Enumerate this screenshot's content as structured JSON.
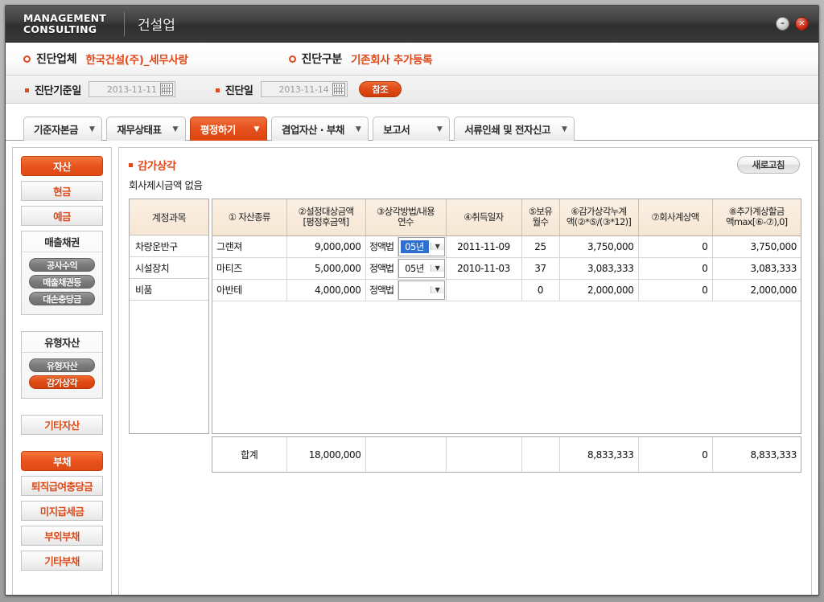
{
  "titlebar": {
    "brand_line1": "MANAGEMENT",
    "brand_line2": "CONSULTING",
    "subtitle": "건설업",
    "minimize_glyph": "–",
    "close_glyph": "✕"
  },
  "info": {
    "company_label": "진단업체",
    "company_value": "한국건설(주)_세무사랑",
    "type_label": "진단구분",
    "type_value": "기존회사  추가등록"
  },
  "dates": {
    "base_label": "진단기준일",
    "base_value": "2013-11-11",
    "diag_label": "진단일",
    "diag_value": "2013-11-14",
    "reference_button": "참조"
  },
  "tabs": [
    {
      "label": "기준자본금",
      "caret": "▼",
      "active": false
    },
    {
      "label": "재무상태표",
      "caret": "▼",
      "active": false
    },
    {
      "label": "평정하기",
      "caret": "▼",
      "active": true
    },
    {
      "label": "겸업자산 · 부채",
      "caret": "▼",
      "active": false
    },
    {
      "label": "보고서",
      "caret": "▼",
      "active": false
    },
    {
      "label": "서류인쇄 및 전자신고",
      "caret": "▼",
      "active": false
    }
  ],
  "sidebar": {
    "items": [
      {
        "kind": "primary",
        "label": "자산"
      },
      {
        "kind": "btn",
        "label": "현금"
      },
      {
        "kind": "btn",
        "label": "예금"
      },
      {
        "kind": "group",
        "label": "매출채권",
        "pills": [
          {
            "label": "공사수익",
            "active": false
          },
          {
            "label": "매출채권등",
            "active": false
          },
          {
            "label": "대손충당금",
            "active": false
          }
        ]
      },
      {
        "kind": "spacer"
      },
      {
        "kind": "group",
        "label": "유형자산",
        "pills": [
          {
            "label": "유형자산",
            "active": false
          },
          {
            "label": "감가상각",
            "active": true
          }
        ]
      },
      {
        "kind": "spacer"
      },
      {
        "kind": "btn",
        "label": "기타자산"
      },
      {
        "kind": "spacer"
      },
      {
        "kind": "primary",
        "label": "부채"
      },
      {
        "kind": "btn",
        "label": "퇴직급여충당금"
      },
      {
        "kind": "btn",
        "label": "미지급세금"
      },
      {
        "kind": "btn",
        "label": "부외부채"
      },
      {
        "kind": "btn",
        "label": "기타부채"
      }
    ]
  },
  "content": {
    "section_title": "감가상각",
    "section_note": "회사제시금액  없음",
    "refresh_button": "새로고침"
  },
  "table": {
    "account_header": "계정과목",
    "headers": [
      {
        "line1": "① 자산종류",
        "line2": ""
      },
      {
        "line1": "②설정대상금액",
        "line2": "[평정후금액]"
      },
      {
        "line1": "③상각방법/내용",
        "line2": "연수"
      },
      {
        "line1": "④취득일자",
        "line2": ""
      },
      {
        "line1": "⑤보유",
        "line2": "월수"
      },
      {
        "line1": "⑥감가상각누계",
        "line2": "액(②*⑤/(③*12)]"
      },
      {
        "line1": "⑦회사계상액",
        "line2": ""
      },
      {
        "line1": "⑧추가계상할금",
        "line2": "액max[⑥-⑦),0]"
      }
    ],
    "rows": [
      {
        "account": "차량운반구",
        "asset_type": "그랜져",
        "amount": "9,000,000",
        "method": "정액법",
        "years": "05년",
        "years_selected": true,
        "acquire_date": "2011-11-09",
        "months": "25",
        "accum_depr": "3,750,000",
        "company_amount": "0",
        "extra_amount": "3,750,000"
      },
      {
        "account": "시설장치",
        "asset_type": "마티즈",
        "amount": "5,000,000",
        "method": "정액법",
        "years": "05년",
        "years_selected": false,
        "acquire_date": "2010-11-03",
        "months": "37",
        "accum_depr": "3,083,333",
        "company_amount": "0",
        "extra_amount": "3,083,333"
      },
      {
        "account": "비품",
        "asset_type": "아반테",
        "amount": "4,000,000",
        "method": "정액법",
        "years": "",
        "years_selected": false,
        "acquire_date": "",
        "months": "0",
        "accum_depr": "2,000,000",
        "company_amount": "0",
        "extra_amount": "2,000,000"
      }
    ],
    "total": {
      "label": "합계",
      "amount": "18,000,000",
      "accum_depr": "8,833,333",
      "company_amount": "0",
      "extra_amount": "8,833,333"
    },
    "dropdown_caret": "▼"
  },
  "colors": {
    "accent": "#e0491b",
    "header_bg": "#f6e6d4",
    "select_blue": "#2f6fd0"
  }
}
